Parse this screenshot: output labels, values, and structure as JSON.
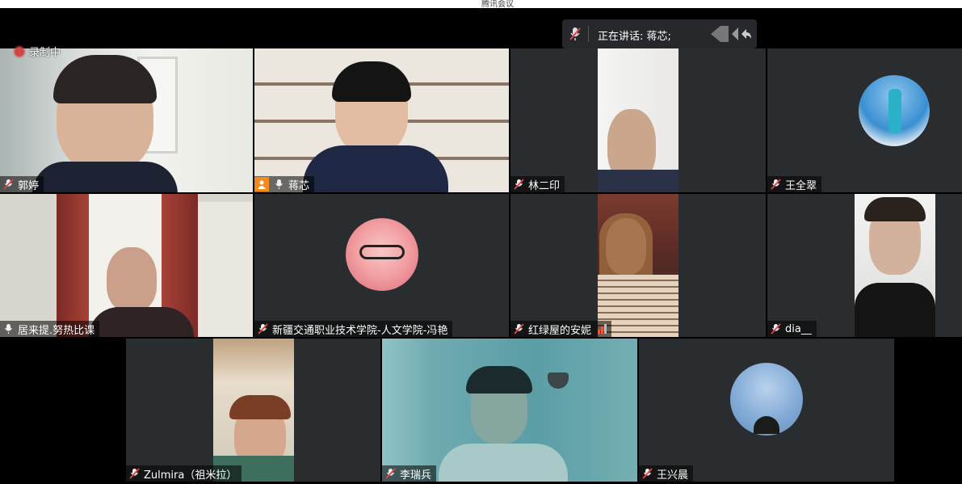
{
  "topbar": {
    "title": "腾讯会议"
  },
  "speaking": {
    "label": "正在讲话: 蒋芯;"
  },
  "recording": {
    "label": "录制中"
  },
  "participants": [
    {
      "name": "郭婷",
      "muted": true
    },
    {
      "name": "蒋芯",
      "muted": false,
      "host": true
    },
    {
      "name": "林二印",
      "muted": true
    },
    {
      "name": "王全翠",
      "muted": true
    },
    {
      "name": "居来提.努热比课",
      "muted": false
    },
    {
      "name": "新疆交通职业技术学院-人文学院-冯艳",
      "muted": true
    },
    {
      "name": "红绿屋的安妮",
      "muted": true,
      "audio_level": 0.6
    },
    {
      "name": "dia__",
      "muted": true
    },
    {
      "name": "Zulmira（祖米拉）",
      "muted": true
    },
    {
      "name": "李瑞兵",
      "muted": true
    },
    {
      "name": "王兴晨",
      "muted": true
    }
  ],
  "colors": {
    "active_speaker_border": "#3ba55d",
    "muted_mic": "#e0e0e0",
    "host_badge": "#f28a1e",
    "rec_dot": "#d24545"
  }
}
